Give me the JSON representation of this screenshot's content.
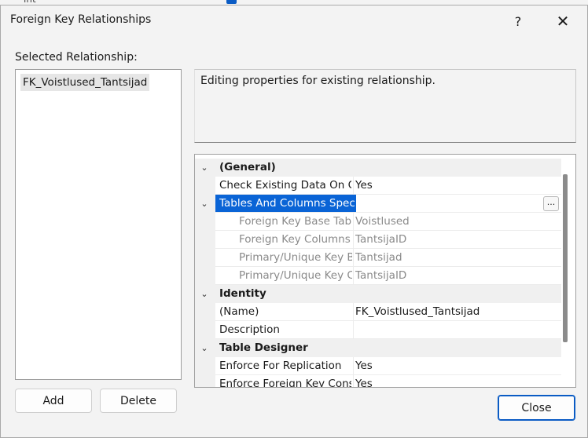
{
  "background_fragment": "int",
  "dialog": {
    "title": "Foreign Key Relationships",
    "help_label": "?",
    "close_label": "✕"
  },
  "selected_relationship": {
    "label": "Selected Relationship:",
    "items": [
      "FK_Voistlused_Tantsijad"
    ]
  },
  "description": "Editing properties for existing relationship.",
  "properties": {
    "general": {
      "category": "(General)",
      "check_existing_name": "Check Existing Data On Cr",
      "check_existing_value": "Yes",
      "tables_columns_name": "Tables And Columns Spec",
      "ellipsis": "...",
      "fk_base_table_name": "Foreign Key Base Tabl",
      "fk_base_table_value": "Voistlused",
      "fk_columns_name": "Foreign Key Columns",
      "fk_columns_value": "TantsijaID",
      "pk_table_name": "Primary/Unique Key B",
      "pk_table_value": "Tantsijad",
      "pk_columns_name": "Primary/Unique Key C",
      "pk_columns_value": "TantsijaID"
    },
    "identity": {
      "category": "Identity",
      "name_name": "(Name)",
      "name_value": "FK_Voistlused_Tantsijad",
      "description_name": "Description",
      "description_value": ""
    },
    "table_designer": {
      "category": "Table Designer",
      "replication_name": "Enforce For Replication",
      "replication_value": "Yes",
      "enforce_fk_name": "Enforce Foreign Key Cons",
      "enforce_fk_value": "Yes"
    }
  },
  "buttons": {
    "add": "Add",
    "delete": "Delete",
    "close": "Close"
  },
  "colors": {
    "selection": "#0a64d6",
    "accent_border": "#0a5bc4"
  }
}
